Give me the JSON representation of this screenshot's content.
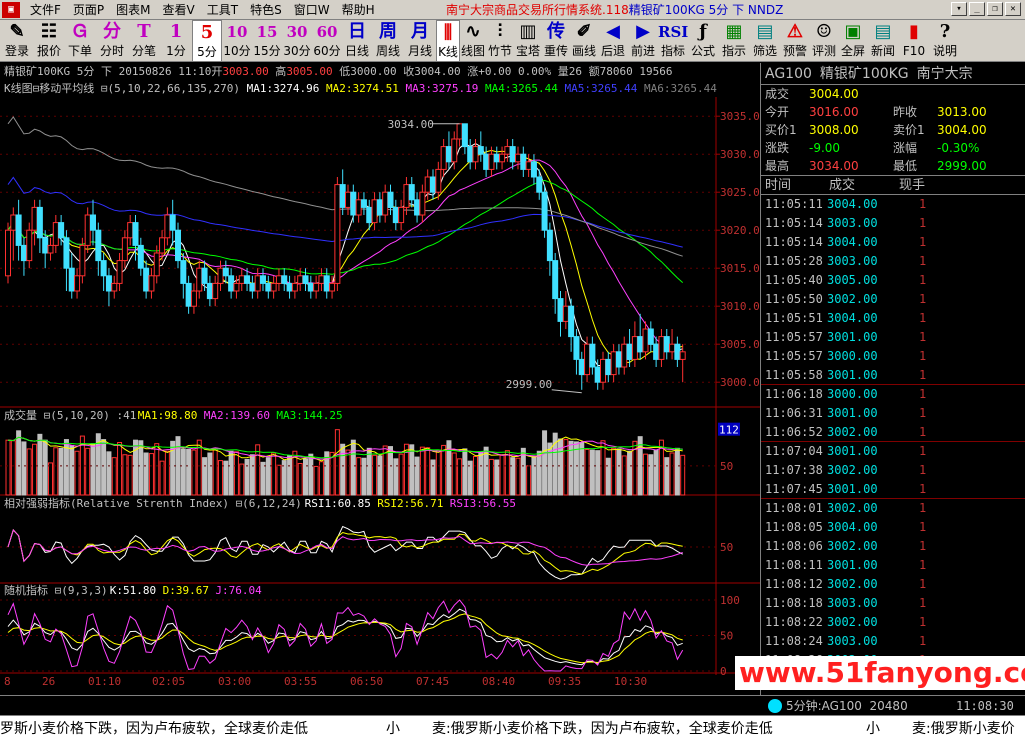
{
  "menu": {
    "items": [
      "文件F",
      "页面P",
      "图表M",
      "查看V",
      "工具T",
      "特色S",
      "窗口W",
      "帮助H"
    ],
    "title_red": "南宁大宗商品交易所行情系统.118",
    "title_blue": "精银矿100KG 5分 下 NNDZ"
  },
  "toolbar": {
    "items": [
      {
        "label": "登录",
        "glyph": "✎",
        "color": "black",
        "name": "login"
      },
      {
        "label": "报价",
        "glyph": "☷",
        "color": "black",
        "name": "quote"
      },
      {
        "label": "下单",
        "glyph": "Ꮐ",
        "color": "purple",
        "name": "order"
      },
      {
        "label": "分时",
        "glyph": "分",
        "color": "purple",
        "name": "timeshare"
      },
      {
        "label": "分笔",
        "glyph": "T",
        "color": "purple",
        "name": "ticks"
      },
      {
        "label": "1分",
        "glyph": "1",
        "color": "purple",
        "name": "1min"
      },
      {
        "label": "5分",
        "glyph": "5",
        "color": "red",
        "name": "5min",
        "active": true
      },
      {
        "label": "10分",
        "glyph": "10",
        "color": "purple",
        "name": "10min"
      },
      {
        "label": "15分",
        "glyph": "15",
        "color": "purple",
        "name": "15min"
      },
      {
        "label": "30分",
        "glyph": "30",
        "color": "purple",
        "name": "30min"
      },
      {
        "label": "60分",
        "glyph": "60",
        "color": "purple",
        "name": "60min"
      },
      {
        "label": "日线",
        "glyph": "日",
        "color": "blue",
        "name": "daily"
      },
      {
        "label": "周线",
        "glyph": "周",
        "color": "blue",
        "name": "weekly"
      },
      {
        "label": "月线",
        "glyph": "月",
        "color": "blue",
        "name": "monthly"
      },
      {
        "label": "K线",
        "glyph": "⫼",
        "color": "red",
        "name": "kline",
        "active": true
      },
      {
        "label": "线图",
        "glyph": "∿",
        "color": "black",
        "name": "linechart"
      },
      {
        "label": "竹节",
        "glyph": "⫶",
        "color": "black",
        "name": "bamboo"
      },
      {
        "label": "宝塔",
        "glyph": "▥",
        "color": "black",
        "name": "tower"
      },
      {
        "label": "重传",
        "glyph": "传",
        "color": "blue",
        "name": "resend"
      },
      {
        "label": "画线",
        "glyph": "✐",
        "color": "black",
        "name": "drawline"
      },
      {
        "label": "后退",
        "glyph": "◀",
        "color": "blue",
        "name": "back"
      },
      {
        "label": "前进",
        "glyph": "▶",
        "color": "blue",
        "name": "forward"
      },
      {
        "label": "指标",
        "glyph": "RSI",
        "color": "blue",
        "name": "indicator"
      },
      {
        "label": "公式",
        "glyph": "ƒ",
        "color": "black",
        "name": "formula"
      },
      {
        "label": "指示",
        "glyph": "▦",
        "color": "green",
        "name": "indicate"
      },
      {
        "label": "筛选",
        "glyph": "▤",
        "color": "teal",
        "name": "filter"
      },
      {
        "label": "预警",
        "glyph": "⚠",
        "color": "red",
        "name": "alert"
      },
      {
        "label": "评测",
        "glyph": "☺",
        "color": "black",
        "name": "evaluate"
      },
      {
        "label": "全屏",
        "glyph": "▣",
        "color": "green",
        "name": "fullscreen"
      },
      {
        "label": "新闻",
        "glyph": "▤",
        "color": "teal",
        "name": "news"
      },
      {
        "label": "F10",
        "glyph": "▮",
        "color": "red",
        "name": "f10"
      },
      {
        "label": "说明",
        "glyph": "?",
        "color": "black",
        "name": "help"
      }
    ]
  },
  "info": {
    "text1": "精银矿100KG 5分 下 20150826 11:10开",
    "open": "3003.00",
    "text2": " 高",
    "high": "3005.00",
    "text3": " 低3000.00 收3004.00 涨+0.00 0.00% 量26 额78060 19566"
  },
  "ma_legend": [
    {
      "text": "K线图",
      "color": "#c0c0c0"
    },
    {
      "text": "⊟移动平均线 ⊟(5,10,22,66,135,270)",
      "color": "#c0c0c0"
    },
    {
      "text": " MA1:3274.96",
      "color": "#ffffff"
    },
    {
      "text": " MA2:3274.51",
      "color": "#ffff00"
    },
    {
      "text": " MA3:3275.19",
      "color": "#ff40ff"
    },
    {
      "text": " MA4:3265.44",
      "color": "#00ff00"
    },
    {
      "text": " MA5:3265.44",
      "color": "#4040ff"
    },
    {
      "text": " MA6:3265.44",
      "color": "#808080"
    }
  ],
  "vol_legend": [
    {
      "text": "成交量 ⊟(5,10,20) :41",
      "color": "#c0c0c0"
    },
    {
      "text": " MA1:98.80",
      "color": "#ffff00"
    },
    {
      "text": " MA2:139.60",
      "color": "#ff40ff"
    },
    {
      "text": " MA3:144.25",
      "color": "#00ff00"
    }
  ],
  "rsi_legend": [
    {
      "text": "相对强弱指标(Relative Strenth Index) ⊟(6,12,24)",
      "color": "#c0c0c0"
    },
    {
      "text": " RSI1:60.85",
      "color": "#ffffff"
    },
    {
      "text": " RSI2:56.71",
      "color": "#ffff00"
    },
    {
      "text": " RSI3:56.55",
      "color": "#ff40ff"
    }
  ],
  "kdj_legend": [
    {
      "text": "随机指标 ⊟(9,3,3)",
      "color": "#c0c0c0"
    },
    {
      "text": " K:51.80",
      "color": "#ffffff"
    },
    {
      "text": " D:39.67",
      "color": "#ffff00"
    },
    {
      "text": " J:76.04",
      "color": "#ff40ff"
    }
  ],
  "chart_data": {
    "type": "candlestick",
    "price_axis": [
      "3035.0",
      "3030.0",
      "3025.0",
      "3020.0",
      "3015.0",
      "3010.0",
      "3005.0",
      "3000.0"
    ],
    "ylim": [
      2997,
      3037
    ],
    "annotations": {
      "high_label": "3034.00",
      "low_label": "2999.00"
    },
    "vol_axis": [
      "112",
      "50"
    ],
    "rsi_axis": [
      "50"
    ],
    "kdj_axis": [
      "100",
      "50",
      "0"
    ],
    "time_axis": [
      "8",
      "26",
      "01:10",
      "02:05",
      "03:00",
      "03:55",
      "06:50",
      "07:45",
      "08:40",
      "09:35",
      "10:30"
    ],
    "candles": [
      [
        3014,
        3020,
        3013,
        3021
      ],
      [
        3020,
        3022,
        3016,
        3023
      ],
      [
        3022,
        3018,
        3016,
        3024
      ],
      [
        3018,
        3016,
        3014,
        3019
      ],
      [
        3016,
        3020,
        3015,
        3021
      ],
      [
        3020,
        3023,
        3018,
        3024
      ],
      [
        3023,
        3019,
        3017,
        3024
      ],
      [
        3019,
        3017,
        3015,
        3020
      ],
      [
        3017,
        3018,
        3016,
        3019
      ],
      [
        3018,
        3021,
        3017,
        3022
      ],
      [
        3021,
        3019,
        3018,
        3022
      ],
      [
        3019,
        3015,
        3012,
        3020
      ],
      [
        3015,
        3012,
        3011,
        3017
      ],
      [
        3012,
        3014,
        3011,
        3015
      ],
      [
        3014,
        3018,
        3013,
        3019
      ],
      [
        3018,
        3022,
        3017,
        3023
      ],
      [
        3022,
        3020,
        3018,
        3024
      ],
      [
        3020,
        3016,
        3014,
        3021
      ],
      [
        3016,
        3014,
        3012,
        3017
      ],
      [
        3014,
        3012,
        3010,
        3015
      ],
      [
        3012,
        3013,
        3011,
        3014
      ],
      [
        3013,
        3016,
        3012,
        3017
      ],
      [
        3016,
        3019,
        3015,
        3020
      ],
      [
        3019,
        3021,
        3018,
        3022
      ],
      [
        3021,
        3018,
        3016,
        3022
      ],
      [
        3018,
        3015,
        3014,
        3019
      ],
      [
        3015,
        3012,
        3011,
        3016
      ],
      [
        3012,
        3014,
        3011,
        3015
      ],
      [
        3014,
        3017,
        3013,
        3018
      ],
      [
        3017,
        3019,
        3016,
        3020
      ],
      [
        3019,
        3022,
        3018,
        3023
      ],
      [
        3022,
        3020,
        3018,
        3024
      ],
      [
        3020,
        3016,
        3015,
        3021
      ],
      [
        3016,
        3013,
        3011,
        3017
      ],
      [
        3013,
        3010,
        3009,
        3014
      ],
      [
        3010,
        3012,
        3009,
        3013
      ],
      [
        3012,
        3015,
        3011,
        3016
      ],
      [
        3015,
        3013,
        3012,
        3016
      ],
      [
        3013,
        3011,
        3010,
        3014
      ],
      [
        3011,
        3013,
        3010,
        3014
      ],
      [
        3013,
        3015,
        3012,
        3016
      ],
      [
        3015,
        3014,
        3013,
        3016
      ],
      [
        3014,
        3012,
        3011,
        3015
      ],
      [
        3012,
        3013,
        3011,
        3014
      ],
      [
        3013,
        3014,
        3012,
        3015
      ],
      [
        3014,
        3013,
        3012,
        3015
      ],
      [
        3013,
        3012,
        3011,
        3014
      ],
      [
        3012,
        3014,
        3011,
        3015
      ],
      [
        3014,
        3013,
        3012,
        3015
      ],
      [
        3013,
        3012,
        3011,
        3014
      ],
      [
        3012,
        3013,
        3011,
        3014
      ],
      [
        3013,
        3014,
        3012,
        3015
      ],
      [
        3014,
        3013,
        3012,
        3015
      ],
      [
        3013,
        3012,
        3011,
        3014
      ],
      [
        3012,
        3013,
        3011,
        3014
      ],
      [
        3013,
        3014,
        3012,
        3015
      ],
      [
        3014,
        3013,
        3012,
        3015
      ],
      [
        3013,
        3012,
        3011,
        3014
      ],
      [
        3012,
        3013,
        3011,
        3014
      ],
      [
        3013,
        3014,
        3012,
        3015
      ],
      [
        3014,
        3012,
        3011,
        3015
      ],
      [
        3012,
        3013,
        3011,
        3014
      ],
      [
        3013,
        3026,
        3012,
        3027
      ],
      [
        3026,
        3023,
        3022,
        3028
      ],
      [
        3023,
        3025,
        3022,
        3026
      ],
      [
        3025,
        3022,
        3021,
        3026
      ],
      [
        3022,
        3024,
        3021,
        3025
      ],
      [
        3024,
        3023,
        3022,
        3025
      ],
      [
        3023,
        3021,
        3020,
        3024
      ],
      [
        3021,
        3024,
        3020,
        3025
      ],
      [
        3024,
        3022,
        3021,
        3025
      ],
      [
        3022,
        3025,
        3021,
        3026
      ],
      [
        3025,
        3023,
        3022,
        3026
      ],
      [
        3023,
        3021,
        3020,
        3024
      ],
      [
        3021,
        3023,
        3020,
        3024
      ],
      [
        3023,
        3026,
        3022,
        3027
      ],
      [
        3026,
        3024,
        3023,
        3027
      ],
      [
        3024,
        3022,
        3021,
        3025
      ],
      [
        3022,
        3025,
        3021,
        3026
      ],
      [
        3025,
        3027,
        3024,
        3028
      ],
      [
        3027,
        3025,
        3024,
        3028
      ],
      [
        3025,
        3028,
        3024,
        3029
      ],
      [
        3028,
        3031,
        3027,
        3032
      ],
      [
        3031,
        3029,
        3028,
        3033
      ],
      [
        3029,
        3032,
        3028,
        3033
      ],
      [
        3032,
        3034,
        3031,
        3034
      ],
      [
        3034,
        3031,
        3030,
        3034
      ],
      [
        3031,
        3029,
        3028,
        3032
      ],
      [
        3029,
        3031,
        3028,
        3032
      ],
      [
        3031,
        3030,
        3029,
        3033
      ],
      [
        3030,
        3028,
        3027,
        3031
      ],
      [
        3028,
        3030,
        3027,
        3031
      ],
      [
        3030,
        3029,
        3028,
        3031
      ],
      [
        3029,
        3030,
        3028,
        3031
      ],
      [
        3030,
        3031,
        3029,
        3032
      ],
      [
        3031,
        3029,
        3028,
        3032
      ],
      [
        3029,
        3030,
        3028,
        3031
      ],
      [
        3030,
        3028,
        3027,
        3031
      ],
      [
        3028,
        3029,
        3027,
        3030
      ],
      [
        3029,
        3027,
        3026,
        3030
      ],
      [
        3027,
        3025,
        3024,
        3028
      ],
      [
        3025,
        3020,
        3019,
        3026
      ],
      [
        3020,
        3016,
        3014,
        3021
      ],
      [
        3016,
        3011,
        3009,
        3017
      ],
      [
        3011,
        3008,
        3006,
        3012
      ],
      [
        3008,
        3010,
        3007,
        3012
      ],
      [
        3010,
        3006,
        3004,
        3011
      ],
      [
        3006,
        3003,
        3001,
        3007
      ],
      [
        3003,
        3001,
        2999,
        3004
      ],
      [
        3001,
        3005,
        3000,
        3006
      ],
      [
        3005,
        3002,
        3001,
        3006
      ],
      [
        3002,
        3000,
        2999,
        3003
      ],
      [
        3000,
        3003,
        2999,
        3004
      ],
      [
        3003,
        3001,
        3000,
        3004
      ],
      [
        3001,
        3004,
        3000,
        3005
      ],
      [
        3004,
        3002,
        3001,
        3005
      ],
      [
        3002,
        3005,
        3001,
        3006
      ],
      [
        3005,
        3003,
        3002,
        3007
      ],
      [
        3003,
        3006,
        3002,
        3008
      ],
      [
        3006,
        3004,
        3003,
        3009
      ],
      [
        3004,
        3007,
        3003,
        3008
      ],
      [
        3007,
        3005,
        3004,
        3008
      ],
      [
        3005,
        3003,
        3002,
        3006
      ],
      [
        3003,
        3006,
        3002,
        3007
      ],
      [
        3006,
        3004,
        3003,
        3007
      ],
      [
        3004,
        3005,
        3003,
        3007
      ],
      [
        3005,
        3003,
        3002,
        3006
      ],
      [
        3003,
        3004,
        3000,
        3005
      ]
    ]
  },
  "panel": {
    "title_code": "AG100",
    "title_name": "精银矿100KG",
    "title_exch": "南宁大宗",
    "rows": [
      {
        "k": "成交",
        "v": "3004.00",
        "vc": "c-yellow",
        "k2": "",
        "v2": "",
        "v2c": ""
      },
      {
        "k": "今开",
        "v": "3016.00",
        "vc": "c-red",
        "k2": "昨收",
        "v2": "3013.00",
        "v2c": "c-yellow"
      },
      {
        "k": "买价1",
        "v": "3008.00",
        "vc": "c-yellow",
        "k2": "卖价1",
        "v2": "3004.00",
        "v2c": "c-yellow"
      },
      {
        "k": "涨跌",
        "v": "-9.00",
        "vc": "c-green",
        "k2": "涨幅",
        "v2": "-0.30%",
        "v2c": "c-green"
      },
      {
        "k": "最高",
        "v": "3034.00",
        "vc": "c-red",
        "k2": "最低",
        "v2": "2999.00",
        "v2c": "c-green"
      }
    ],
    "tick_head": {
      "time": "时间",
      "price": "成交",
      "vol": "现手"
    },
    "ticks": [
      {
        "t": "11:05:11",
        "p": "3004.00",
        "v": "1"
      },
      {
        "t": "11:05:14",
        "p": "3003.00",
        "v": "1"
      },
      {
        "t": "11:05:14",
        "p": "3004.00",
        "v": "1"
      },
      {
        "t": "11:05:28",
        "p": "3003.00",
        "v": "1"
      },
      {
        "t": "11:05:40",
        "p": "3005.00",
        "v": "1"
      },
      {
        "t": "11:05:50",
        "p": "3002.00",
        "v": "1"
      },
      {
        "t": "11:05:51",
        "p": "3004.00",
        "v": "1"
      },
      {
        "t": "11:05:57",
        "p": "3001.00",
        "v": "1"
      },
      {
        "t": "11:05:57",
        "p": "3000.00",
        "v": "1"
      },
      {
        "t": "11:05:58",
        "p": "3001.00",
        "v": "1",
        "sep": true
      },
      {
        "t": "11:06:18",
        "p": "3000.00",
        "v": "1"
      },
      {
        "t": "11:06:31",
        "p": "3001.00",
        "v": "1"
      },
      {
        "t": "11:06:52",
        "p": "3002.00",
        "v": "1",
        "sep": true
      },
      {
        "t": "11:07:04",
        "p": "3001.00",
        "v": "1"
      },
      {
        "t": "11:07:38",
        "p": "3002.00",
        "v": "1"
      },
      {
        "t": "11:07:45",
        "p": "3001.00",
        "v": "1",
        "sep": true
      },
      {
        "t": "11:08:01",
        "p": "3002.00",
        "v": "1"
      },
      {
        "t": "11:08:05",
        "p": "3004.00",
        "v": "1"
      },
      {
        "t": "11:08:06",
        "p": "3002.00",
        "v": "1"
      },
      {
        "t": "11:08:11",
        "p": "3001.00",
        "v": "1"
      },
      {
        "t": "11:08:12",
        "p": "3002.00",
        "v": "1"
      },
      {
        "t": "11:08:18",
        "p": "3003.00",
        "v": "1"
      },
      {
        "t": "11:08:22",
        "p": "3002.00",
        "v": "1"
      },
      {
        "t": "11:08:24",
        "p": "3003.00",
        "v": "1"
      },
      {
        "t": "11:08:26",
        "p": "3002.00",
        "v": "1"
      }
    ]
  },
  "status": {
    "period": "5分钟:AG100",
    "vol": "20480",
    "time": "11:08:30"
  },
  "news": {
    "items": [
      "罗斯小麦价格下跌，因为卢布疲软，全球麦价走低",
      "小",
      "麦:俄罗斯小麦价格下跌，因为卢布疲软，全球麦价走低",
      "小",
      "麦:俄罗斯小麦价"
    ]
  },
  "watermark": "www.51fanyong.com"
}
